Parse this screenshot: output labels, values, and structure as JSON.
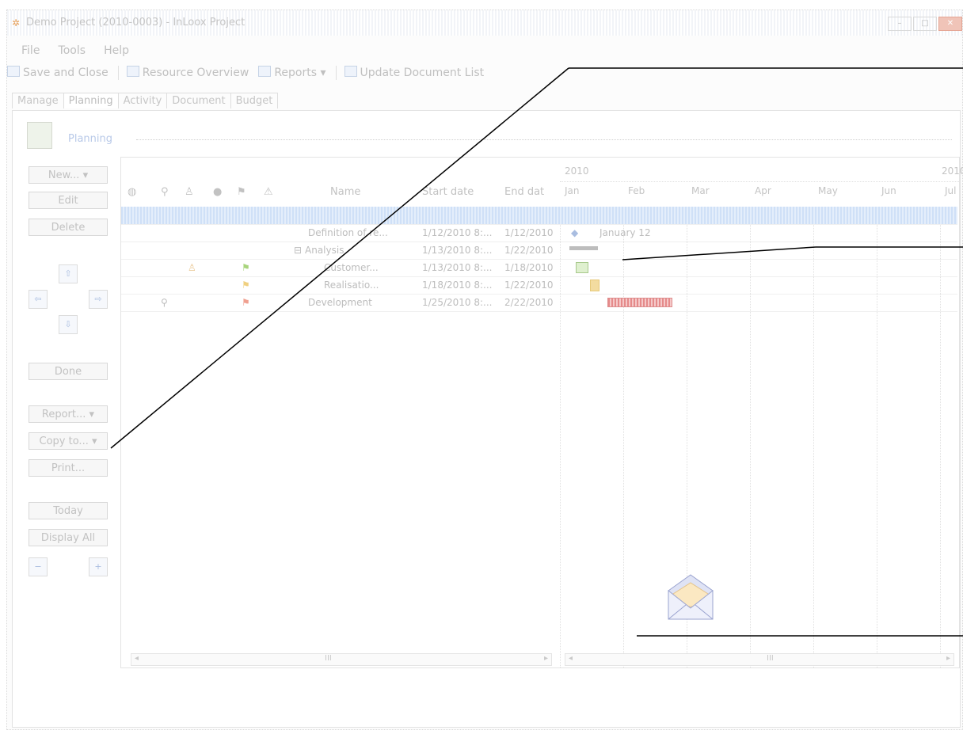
{
  "window": {
    "title": "Demo Project (2010-0003) - InLoox Project"
  },
  "menu": [
    "File",
    "Tools",
    "Help"
  ],
  "toolbar": {
    "save_close": "Save and Close",
    "resource_overview": "Resource Overview",
    "reports": "Reports",
    "update_docs": "Update Document List"
  },
  "tabs": [
    "Manage",
    "Planning",
    "Activity",
    "Document",
    "Budget"
  ],
  "section": {
    "title": "Planning"
  },
  "sidebar": {
    "new": "New...",
    "edit": "Edit",
    "delete": "Delete",
    "done": "Done",
    "report": "Report...",
    "copy_to": "Copy to...",
    "print": "Print...",
    "today": "Today",
    "display_all": "Display All"
  },
  "table": {
    "headers": {
      "name": "Name",
      "start": "Start date",
      "end": "End dat"
    },
    "rows": [
      {
        "name": "Definition of re...",
        "start": "1/12/2010 8:...",
        "end": "1/12/2010"
      },
      {
        "name": "Analysis",
        "start": "1/13/2010 8:...",
        "end": "1/22/2010"
      },
      {
        "name": "Customer...",
        "start": "1/13/2010 8:...",
        "end": "1/18/2010"
      },
      {
        "name": "Realisatio...",
        "start": "1/18/2010 8:...",
        "end": "1/22/2010"
      },
      {
        "name": "Development",
        "start": "1/25/2010 8:...",
        "end": "2/22/2010"
      }
    ]
  },
  "gantt": {
    "year_left": "2010",
    "year_right": "2010",
    "months": [
      "Jan",
      "Feb",
      "Mar",
      "Apr",
      "May",
      "Jun",
      "Jul"
    ],
    "milestone_label": "January 12"
  },
  "scroll": {
    "left_mid": "III",
    "right_mid": "III"
  },
  "colors": {
    "selection": "#cfe0f7",
    "progress_red": "#e58a8a",
    "task_yellow": "#f3dca0"
  }
}
